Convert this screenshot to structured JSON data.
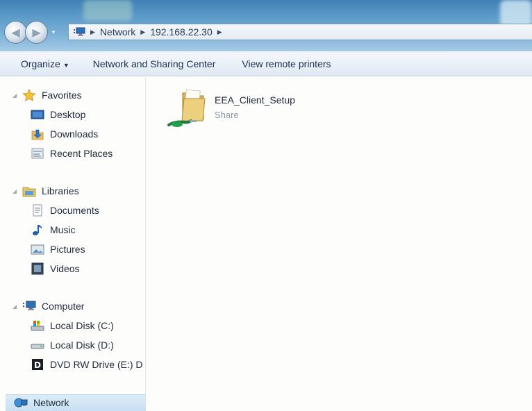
{
  "address_bar": {
    "crumbs": [
      "Network",
      "192.168.22.30"
    ]
  },
  "toolbar": {
    "organize_label": "Organize",
    "network_sharing_label": "Network and Sharing Center",
    "view_printers_label": "View remote printers"
  },
  "nav": {
    "favorites": {
      "title": "Favorites",
      "items": [
        {
          "label": "Desktop",
          "icon": "desktop-icon"
        },
        {
          "label": "Downloads",
          "icon": "downloads-icon"
        },
        {
          "label": "Recent Places",
          "icon": "recent-places-icon"
        }
      ]
    },
    "libraries": {
      "title": "Libraries",
      "items": [
        {
          "label": "Documents",
          "icon": "documents-icon"
        },
        {
          "label": "Music",
          "icon": "music-icon"
        },
        {
          "label": "Pictures",
          "icon": "pictures-icon"
        },
        {
          "label": "Videos",
          "icon": "videos-icon"
        }
      ]
    },
    "computer": {
      "title": "Computer",
      "items": [
        {
          "label": "Local Disk (C:)",
          "icon": "local-disk-c-icon"
        },
        {
          "label": "Local Disk (D:)",
          "icon": "local-disk-d-icon"
        },
        {
          "label": "DVD RW Drive (E:) D",
          "icon": "dvd-drive-icon"
        }
      ]
    },
    "network_label": "Network"
  },
  "content": {
    "items": [
      {
        "name": "EEA_Client_Setup",
        "type": "Share",
        "icon": "shared-folder-icon"
      }
    ]
  },
  "colors": {
    "titlebar": "#5a99c8",
    "selection": "#cfe3f4",
    "folder": "#e9c670"
  }
}
